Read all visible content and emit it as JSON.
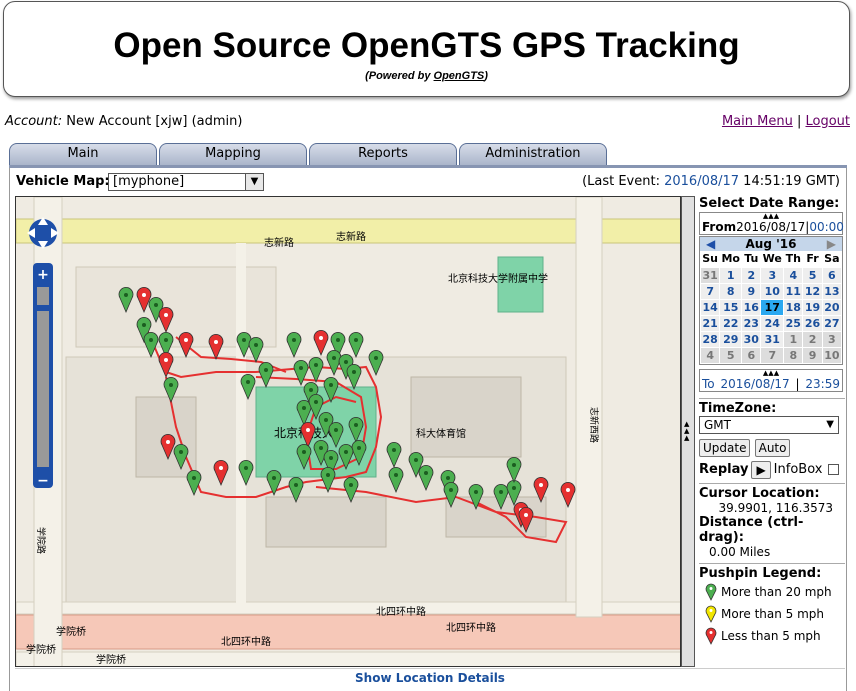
{
  "banner": {
    "title": "Open Source OpenGTS GPS Tracking",
    "powered_prefix": "(Powered by ",
    "powered_link": "OpenGTS",
    "powered_suffix": ")"
  },
  "account": {
    "label": "Account:",
    "value": "New Account [xjw] (admin)"
  },
  "links": {
    "main_menu": "Main Menu",
    "sep": "|",
    "logout": "Logout"
  },
  "tabs": [
    "Main",
    "Mapping",
    "Reports",
    "Administration"
  ],
  "vehicle": {
    "label": "Vehicle Map:",
    "selected": "[myphone]"
  },
  "last_event": {
    "prefix": "(Last Event: ",
    "date": "2016/08/17",
    "time": " 14:51:19 GMT)"
  },
  "map": {
    "roads": {
      "zhixin": "志新路",
      "beisihuan": "北四环中路",
      "xueyuan": "学院路",
      "xueyuanqiao": "学院桥",
      "zhichunxi": "志新西路"
    },
    "places": {
      "school": "北京科技大学附属中学",
      "gym": "科大体育馆",
      "univ": "北京科技大"
    }
  },
  "side": {
    "date_range": "Select Date Range:",
    "from_label": "From",
    "from_date": "2016/08/17",
    "from_time": "00:00",
    "month": "Aug '16",
    "weekdays": [
      "Su",
      "Mo",
      "Tu",
      "We",
      "Th",
      "Fr",
      "Sa"
    ],
    "weeks": [
      [
        "31",
        "1",
        "2",
        "3",
        "4",
        "5",
        "6"
      ],
      [
        "7",
        "8",
        "9",
        "10",
        "11",
        "12",
        "13"
      ],
      [
        "14",
        "15",
        "16",
        "17",
        "18",
        "19",
        "20"
      ],
      [
        "21",
        "22",
        "23",
        "24",
        "25",
        "26",
        "27"
      ],
      [
        "28",
        "29",
        "30",
        "31",
        "1",
        "2",
        "3"
      ],
      [
        "4",
        "5",
        "6",
        "7",
        "8",
        "9",
        "10"
      ]
    ],
    "to_label": "To",
    "to_date": "2016/08/17",
    "to_time": "23:59",
    "timezone_label": "TimeZone:",
    "timezone": "GMT",
    "update": "Update",
    "auto": "Auto",
    "replay": "Replay",
    "infobox": "InfoBox",
    "cursor_label": "Cursor Location:",
    "cursor_value": "39.9901, 116.3573",
    "distance_label": "Distance (ctrl-drag):",
    "distance_value": "0.00 Miles",
    "legend_label": "Pushpin Legend:",
    "legend": [
      {
        "text": "More than 20 mph",
        "color": "#4caf50"
      },
      {
        "text": "More than 5 mph",
        "color": "#f2e600"
      },
      {
        "text": "Less than 5 mph",
        "color": "#e53030"
      }
    ]
  },
  "details_link": "Show Location Details"
}
